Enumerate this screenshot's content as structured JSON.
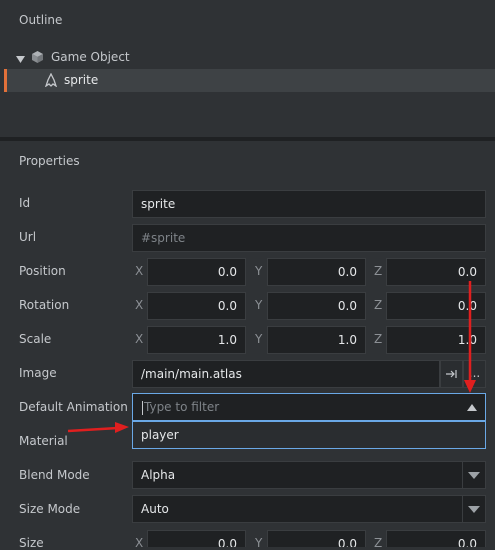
{
  "outline": {
    "title": "Outline",
    "items": [
      {
        "label": "Game Object",
        "icon": "cube-icon"
      },
      {
        "label": "sprite",
        "icon": "sprite-icon"
      }
    ]
  },
  "properties": {
    "title": "Properties",
    "id": {
      "label": "Id",
      "value": "sprite"
    },
    "url": {
      "label": "Url",
      "placeholder": "#sprite"
    },
    "position": {
      "label": "Position",
      "x": "0.0",
      "y": "0.0",
      "z": "0.0"
    },
    "rotation": {
      "label": "Rotation",
      "x": "0.0",
      "y": "0.0",
      "z": "0.0"
    },
    "scale": {
      "label": "Scale",
      "x": "1.0",
      "y": "1.0",
      "z": "1.0"
    },
    "image": {
      "label": "Image",
      "value": "/main/main.atlas",
      "more": "..."
    },
    "default_animation": {
      "label": "Default Animation",
      "placeholder": "Type to filter",
      "options": [
        "player"
      ]
    },
    "material": {
      "label": "Material"
    },
    "blend_mode": {
      "label": "Blend Mode",
      "value": "Alpha"
    },
    "size_mode": {
      "label": "Size Mode",
      "value": "Auto"
    },
    "size": {
      "label": "Size",
      "x": "0.0",
      "y": "0.0",
      "z": "0.0"
    }
  },
  "axes": {
    "x": "X",
    "y": "Y",
    "z": "Z"
  },
  "colors": {
    "accent": "#e2713a",
    "focus": "#6aa8e6",
    "annotation": "#e01f1f"
  }
}
